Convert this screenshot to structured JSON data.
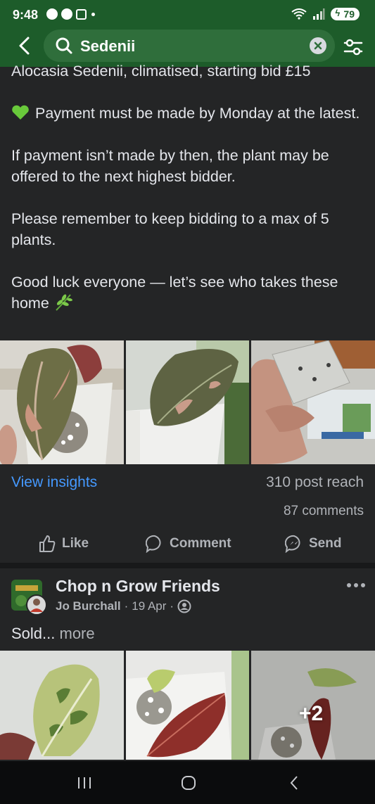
{
  "status": {
    "time": "9:48",
    "battery": "79"
  },
  "search": {
    "query": "Sedenii"
  },
  "post": {
    "lines": [
      "Alocasia Sedenii, climatised, starting bid £15",
      "Payment must be made by Monday at the latest.",
      "If payment isn’t made by then, the plant may be offered to the next highest bidder.",
      "Please remember to keep bidding to a max of 5 plants.",
      "Good luck everyone — let’s see who takes these home"
    ],
    "insights_label": "View insights",
    "reach": "310 post reach",
    "comments": "87 comments",
    "actions": {
      "like": "Like",
      "comment": "Comment",
      "send": "Send"
    }
  },
  "post2": {
    "group": "Chop n Grow Friends",
    "author": "Jo Burchall",
    "date": "19 Apr",
    "text": "Sold...",
    "more": "more",
    "extra_photos": "+2"
  },
  "colors": {
    "header": "#1d5c2a",
    "background": "#242526",
    "link": "#4599ff"
  }
}
